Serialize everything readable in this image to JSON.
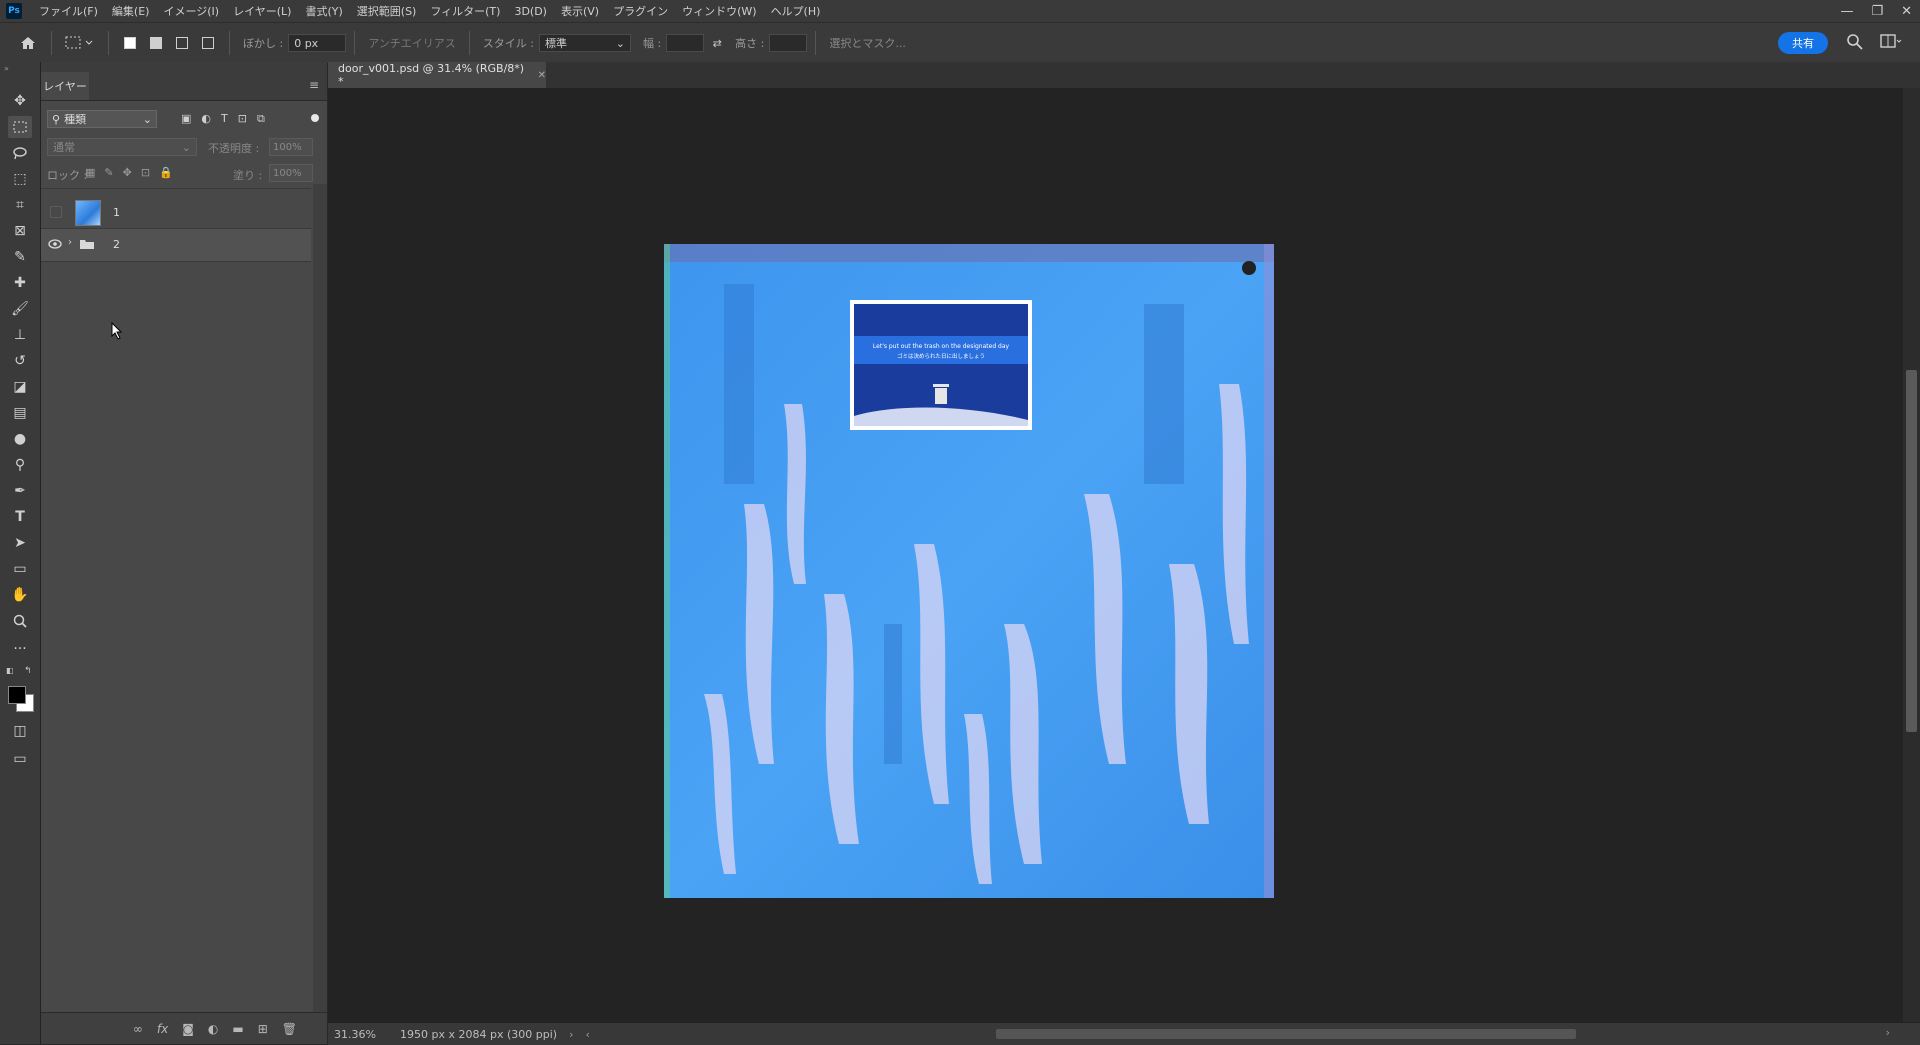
{
  "app": {
    "logo": "Ps",
    "menu": [
      "ファイル(F)",
      "編集(E)",
      "イメージ(I)",
      "レイヤー(L)",
      "書式(Y)",
      "選択範囲(S)",
      "フィルター(T)",
      "3D(D)",
      "表示(V)",
      "プラグイン",
      "ウィンドウ(W)",
      "ヘルプ(H)"
    ]
  },
  "options": {
    "feather_label": "ぼかし :",
    "feather_value": "0 px",
    "antialias_label": "アンチエイリアス",
    "style_label": "スタイル :",
    "style_value": "標準",
    "width_label": "幅 :",
    "height_label": "高さ :",
    "select_mask": "選択とマスク...",
    "share": "共有"
  },
  "layers": {
    "tab": "レイヤー",
    "kind_filter": "種類",
    "blend_mode": "通常",
    "opacity_label": "不透明度 :",
    "opacity_value": "100%",
    "lock_label": "ロック :",
    "fill_label": "塗り :",
    "fill_value": "100%",
    "items": [
      {
        "name": "1",
        "visible": false,
        "type": "image"
      },
      {
        "name": "2",
        "visible": true,
        "type": "group"
      }
    ]
  },
  "document": {
    "tab_title": "door_v001.psd @ 31.4% (RGB/8*) *",
    "sign_en": "Let's put out the trash on the designated day",
    "sign_ja": "ゴミは決められた日に出しましょう"
  },
  "status": {
    "zoom": "31.36%",
    "info": "1950 px x 2084 px (300 ppi)"
  },
  "colors": {
    "accent": "#1473e6",
    "door": "#4aa3f5"
  }
}
